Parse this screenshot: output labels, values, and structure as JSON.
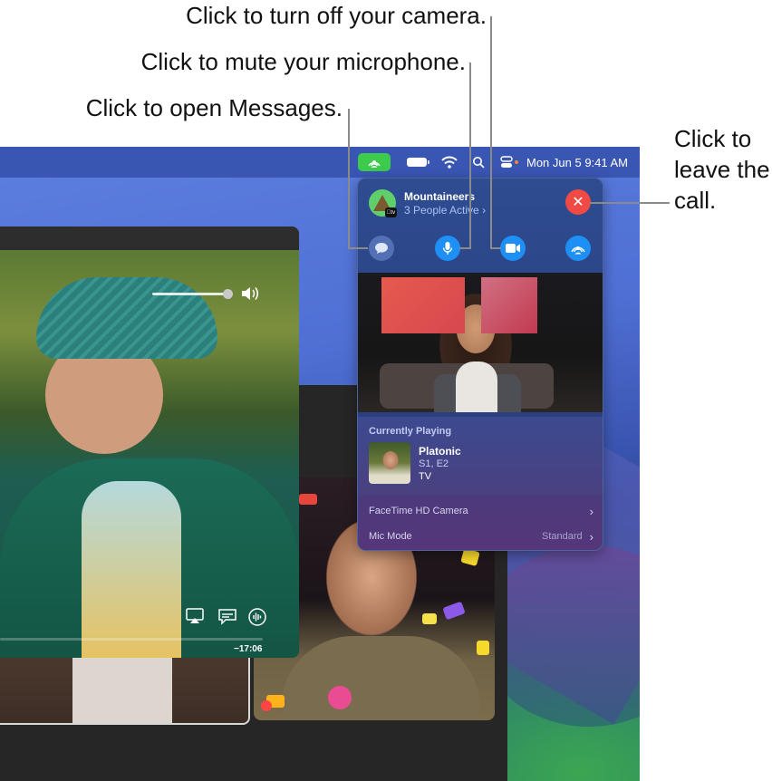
{
  "callouts": {
    "camera": "Click to turn off your camera.",
    "microphone": "Click to mute your microphone.",
    "messages": "Click to open Messages.",
    "leave": "Click to leave the call."
  },
  "menubar": {
    "icons": [
      "facetime-status-icon",
      "battery-icon",
      "wifi-icon",
      "spotlight-search-icon",
      "control-center-icon"
    ],
    "clock": "Mon Jun 5  9:41 AM",
    "accent_color": "#3dcb4e"
  },
  "player": {
    "time_remaining": "−17:06",
    "volume": 0.85,
    "controls": [
      "airplay-icon",
      "subtitles-icon",
      "audio-options-icon"
    ]
  },
  "panel": {
    "group_name": "Mountaineers",
    "group_status": "3 People Active",
    "group_badge": "tv",
    "leave_color": "#f04a44",
    "buttons": {
      "messages": "messages-icon",
      "microphone": "microphone-icon",
      "camera": "video-camera-icon",
      "shareplay": "shareplay-icon"
    },
    "currently_playing": {
      "label": "Currently Playing",
      "title": "Platonic",
      "episode": "S1, E2",
      "type": "TV"
    },
    "settings": [
      {
        "label": "FaceTime HD Camera",
        "value": ""
      },
      {
        "label": "Mic Mode",
        "value": "Standard"
      }
    ]
  }
}
